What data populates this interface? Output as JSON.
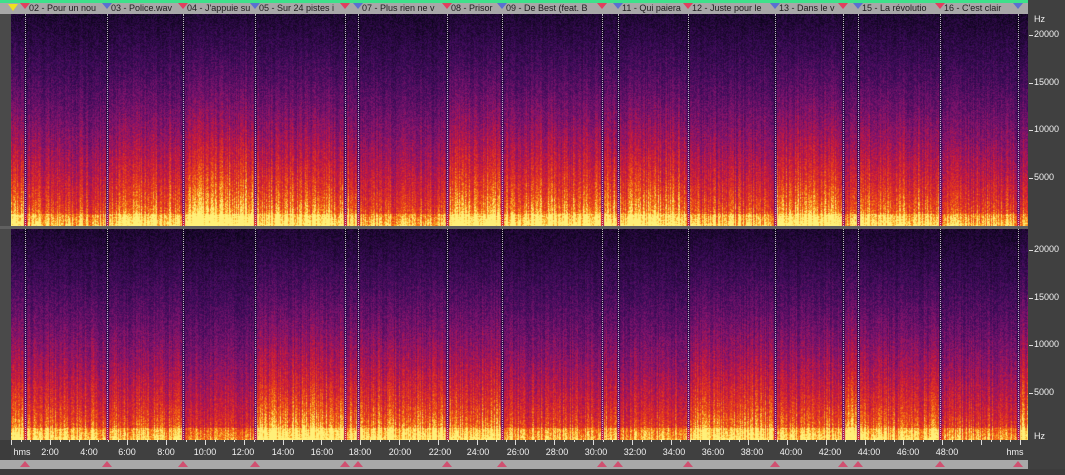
{
  "markers": [
    {
      "label": "02 - Pour un nou"
    },
    {
      "label": "03 - Police.wav"
    },
    {
      "label": "04 - J'appuie su"
    },
    {
      "label": "05 - Sur 24 pistes i"
    },
    {
      "label": ""
    },
    {
      "label": "07 - Plus rien ne v"
    },
    {
      "label": "08 - Prisor"
    },
    {
      "label": "09 - De Best (feat. B"
    },
    {
      "label": ""
    },
    {
      "label": "11 - Qui paiera"
    },
    {
      "label": "12 - Juste pour le"
    },
    {
      "label": "13 - Dans le v"
    },
    {
      "label": ""
    },
    {
      "label": "15 - La révolutio"
    },
    {
      "label": "16 - C'est clair"
    },
    {
      "label": ""
    }
  ],
  "freq_axis": {
    "unit": "Hz",
    "ticks": [
      "20000",
      "15000",
      "10000",
      "5000"
    ]
  },
  "time_axis": {
    "unit_left": "hms",
    "unit_right": "hms",
    "ticks": [
      "2:00",
      "4:00",
      "6:00",
      "8:00",
      "10:00",
      "12:00",
      "14:00",
      "16:00",
      "18:00",
      "20:00",
      "22:00",
      "24:00",
      "26:00",
      "28:00",
      "30:00",
      "32:00",
      "34:00",
      "36:00",
      "38:00",
      "40:00",
      "42:00",
      "44:00",
      "46:00",
      "48:00"
    ]
  },
  "colors": {
    "accent_green": "#3ee08a",
    "marker_red": "#e04060",
    "marker_blue": "#5a70d0"
  }
}
